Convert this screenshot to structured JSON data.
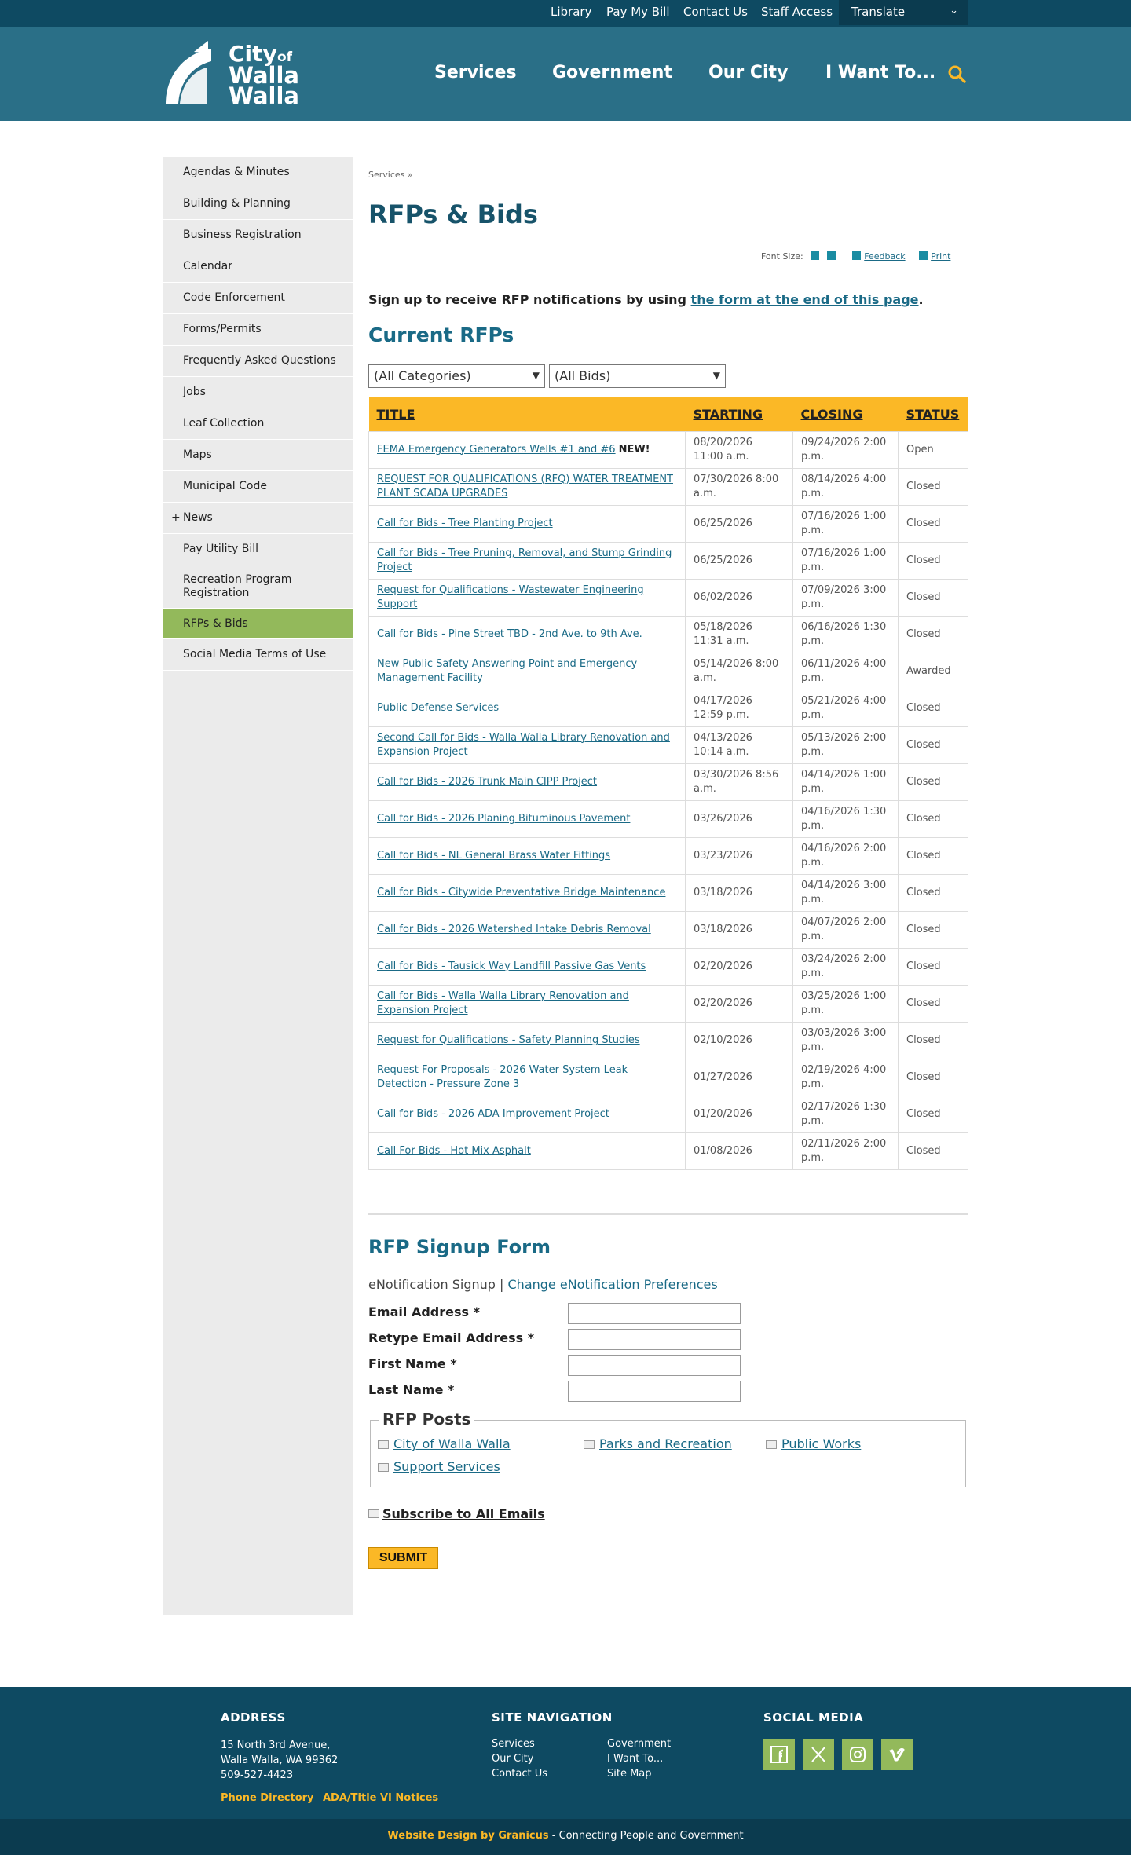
{
  "utility": {
    "library": "Library",
    "pay_bill": "Pay My Bill",
    "contact": "Contact Us",
    "staff": "Staff Access",
    "translate": "Translate"
  },
  "logo": {
    "line1": "City",
    "of": "of",
    "line2": "Walla",
    "line3": "Walla"
  },
  "nav": {
    "services": "Services",
    "government": "Government",
    "our_city": "Our City",
    "i_want": "I Want To..."
  },
  "sidebar": {
    "items": [
      {
        "label": "Agendas & Minutes"
      },
      {
        "label": "Building & Planning"
      },
      {
        "label": "Business Registration"
      },
      {
        "label": "Calendar"
      },
      {
        "label": "Code Enforcement"
      },
      {
        "label": "Forms/Permits"
      },
      {
        "label": "Frequently Asked Questions"
      },
      {
        "label": "Jobs"
      },
      {
        "label": "Leaf Collection"
      },
      {
        "label": "Maps"
      },
      {
        "label": "Municipal Code"
      },
      {
        "label": "News"
      },
      {
        "label": "Pay Utility Bill"
      },
      {
        "label": "Recreation Program Registration"
      },
      {
        "label": "RFPs & Bids"
      },
      {
        "label": "Social Media Terms of Use"
      }
    ]
  },
  "breadcrumb": "Services »",
  "page_title": "RFPs & Bids",
  "tools": {
    "font_size": "Font Size:",
    "feedback": "Feedback",
    "print": "Print"
  },
  "signup_line": {
    "text": "Sign up to receive RFP notifications by using ",
    "link": "the form at the end of this page",
    "end": "."
  },
  "current_title": "Current RFPs",
  "filters": {
    "category": "(All Categories)",
    "bids": "(All Bids)"
  },
  "table": {
    "headers": {
      "title": "TITLE",
      "starting": "STARTING",
      "closing": "CLOSING",
      "status": "STATUS"
    },
    "new_tag": "NEW!",
    "rows": [
      {
        "title": "FEMA Emergency Generators Wells #1 and #6",
        "start": "08/20/2026 11:00 a.m.",
        "close": "09/24/2026 2:00 p.m.",
        "status": "Open"
      },
      {
        "title": "REQUEST FOR QUALIFICATIONS (RFQ) WATER TREATMENT PLANT SCADA UPGRADES",
        "start": "07/30/2026 8:00 a.m.",
        "close": "08/14/2026 4:00 p.m.",
        "status": "Closed"
      },
      {
        "title": "Call for Bids - Tree Planting Project",
        "start": "06/25/2026",
        "close": "07/16/2026 1:00 p.m.",
        "status": "Closed"
      },
      {
        "title": "Call for Bids - Tree Pruning, Removal, and Stump Grinding Project",
        "start": "06/25/2026",
        "close": "07/16/2026 1:00 p.m.",
        "status": "Closed"
      },
      {
        "title": "Request for Qualifications - Wastewater Engineering Support",
        "start": "06/02/2026",
        "close": "07/09/2026 3:00 p.m.",
        "status": "Closed"
      },
      {
        "title": "Call for Bids - Pine Street TBD - 2nd Ave. to 9th Ave.",
        "start": "05/18/2026 11:31 a.m.",
        "close": "06/16/2026 1:30 p.m.",
        "status": "Closed"
      },
      {
        "title": "New Public Safety Answering Point and Emergency Management Facility",
        "start": "05/14/2026 8:00 a.m.",
        "close": "06/11/2026 4:00 p.m.",
        "status": "Awarded"
      },
      {
        "title": "Public Defense Services",
        "start": "04/17/2026 12:59 p.m.",
        "close": "05/21/2026 4:00 p.m.",
        "status": "Closed"
      },
      {
        "title": "Second Call for Bids - Walla Walla Library Renovation and Expansion Project",
        "start": "04/13/2026 10:14 a.m.",
        "close": "05/13/2026 2:00 p.m.",
        "status": "Closed"
      },
      {
        "title": "Call for Bids - 2026 Trunk Main CIPP Project",
        "start": "03/30/2026 8:56 a.m.",
        "close": "04/14/2026 1:00 p.m.",
        "status": "Closed"
      },
      {
        "title": "Call for Bids - 2026 Planing Bituminous Pavement",
        "start": "03/26/2026",
        "close": "04/16/2026 1:30 p.m.",
        "status": "Closed"
      },
      {
        "title": "Call for Bids - NL General Brass Water Fittings",
        "start": "03/23/2026",
        "close": "04/16/2026 2:00 p.m.",
        "status": "Closed"
      },
      {
        "title": "Call for Bids - Citywide Preventative Bridge Maintenance",
        "start": "03/18/2026",
        "close": "04/14/2026 3:00 p.m.",
        "status": "Closed"
      },
      {
        "title": "Call for Bids - 2026 Watershed Intake Debris Removal",
        "start": "03/18/2026",
        "close": "04/07/2026 2:00 p.m.",
        "status": "Closed"
      },
      {
        "title": "Call for Bids - Tausick Way Landfill Passive Gas Vents",
        "start": "02/20/2026",
        "close": "03/24/2026 2:00 p.m.",
        "status": "Closed"
      },
      {
        "title": "Call for Bids - Walla Walla Library Renovation and Expansion Project",
        "start": "02/20/2026",
        "close": "03/25/2026 1:00 p.m.",
        "status": "Closed"
      },
      {
        "title": "Request for Qualifications - Safety Planning Studies",
        "start": "02/10/2026",
        "close": "03/03/2026 3:00 p.m.",
        "status": "Closed"
      },
      {
        "title": "Request For Proposals - 2026 Water System Leak Detection - Pressure Zone 3",
        "start": "01/27/2026",
        "close": "02/19/2026 4:00 p.m.",
        "status": "Closed"
      },
      {
        "title": "Call for Bids - 2026 ADA Improvement Project",
        "start": "01/20/2026",
        "close": "02/17/2026 1:30 p.m.",
        "status": "Closed"
      },
      {
        "title": "Call For Bids - Hot Mix Asphalt",
        "start": "01/08/2026",
        "close": "02/11/2026 2:00 p.m.",
        "status": "Closed"
      }
    ]
  },
  "form": {
    "title": "RFP Signup Form",
    "enotify_text": "eNotification Signup | ",
    "enotify_link": "Change eNotification Preferences",
    "email": "Email Address *",
    "retype": "Retype Email Address *",
    "first": "First Name *",
    "last": "Last Name *",
    "posts_legend": "RFP Posts",
    "posts": [
      "City of Walla Walla",
      "Parks and Recreation",
      "Public Works",
      "Support Services"
    ],
    "subscribe_all": "Subscribe to All Emails",
    "submit": "SUBMIT"
  },
  "footer": {
    "address_head": "ADDRESS",
    "address_line1": "15 North 3rd Avenue,",
    "address_line2": "Walla Walla, WA 99362",
    "phone": "509-527-4423",
    "phone_directory": "Phone Directory",
    "ada": "ADA/Title VI Notices",
    "site_nav_head": "SITE NAVIGATION",
    "nav": [
      "Services",
      "Our City",
      "Contact Us",
      "Government",
      "I Want To...",
      "Site Map"
    ],
    "social_head": "SOCIAL MEDIA",
    "credit": "Website Design by Granicus",
    "tagline": " - Connecting People and Government"
  },
  "colors": {
    "header": "#2a6f87",
    "topbar": "#0e4a62",
    "accent": "#fbb826",
    "active": "#93b95b"
  },
  "icons": [
    "search-icon",
    "plus-icon",
    "minus-icon",
    "feedback-icon",
    "print-icon",
    "chevron-down-icon",
    "facebook-icon",
    "x-icon",
    "instagram-icon",
    "vimeo-icon"
  ]
}
